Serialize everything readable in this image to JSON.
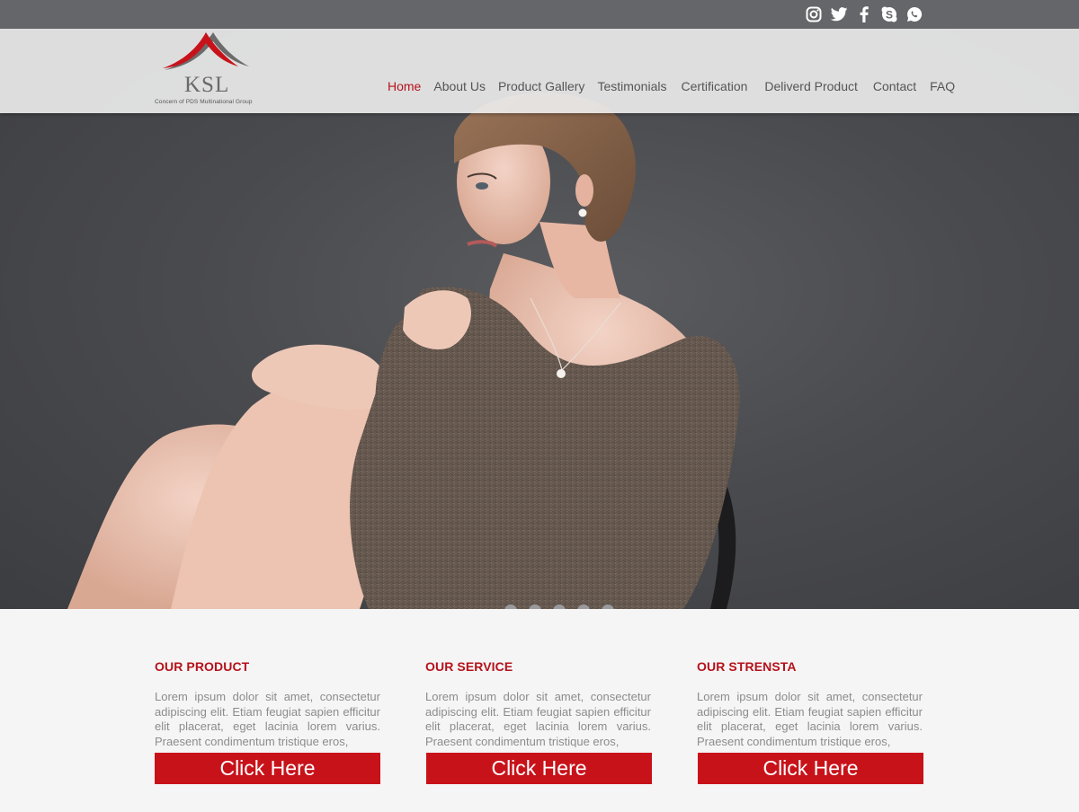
{
  "colors": {
    "accent": "#c8121a",
    "topbar": "#65666a",
    "nav_text": "#555555",
    "body_text": "#8c8c8c"
  },
  "social": [
    {
      "name": "instagram-icon"
    },
    {
      "name": "twitter-icon"
    },
    {
      "name": "facebook-icon"
    },
    {
      "name": "skype-icon"
    },
    {
      "name": "whatsapp-icon"
    }
  ],
  "logo": {
    "text": "KSL",
    "subtitle": "Concern of PDS Multinational Group"
  },
  "nav": {
    "items": [
      {
        "label": "Home",
        "active": true
      },
      {
        "label": "About Us"
      },
      {
        "label": "Product Gallery"
      },
      {
        "label": "Testimonials"
      },
      {
        "label": "Certification"
      },
      {
        "label": "Deliverd Product"
      },
      {
        "label": "Contact"
      },
      {
        "label": "FAQ"
      }
    ]
  },
  "slider": {
    "slide_count": 5
  },
  "features": [
    {
      "title": "OUR PRODUCT",
      "text": "Lorem ipsum dolor sit amet, consectetur adipiscing elit. Etiam feugiat sapien efficitur elit placerat, eget lacinia lorem varius. Praesent condimentum tristique eros,",
      "button": "Click Here"
    },
    {
      "title": "OUR SERVICE",
      "text": "Lorem ipsum dolor sit amet, consectetur adipiscing elit. Etiam feugiat sapien efficitur elit placerat, eget lacinia lorem varius. Praesent condimentum tristique eros,",
      "button": "Click Here"
    },
    {
      "title": "OUR STRENSTA",
      "text": "Lorem ipsum dolor sit amet, consectetur adipiscing elit. Etiam feugiat sapien efficitur elit placerat, eget lacinia lorem varius. Praesent condimentum tristique eros,",
      "button": "Click Here"
    }
  ]
}
